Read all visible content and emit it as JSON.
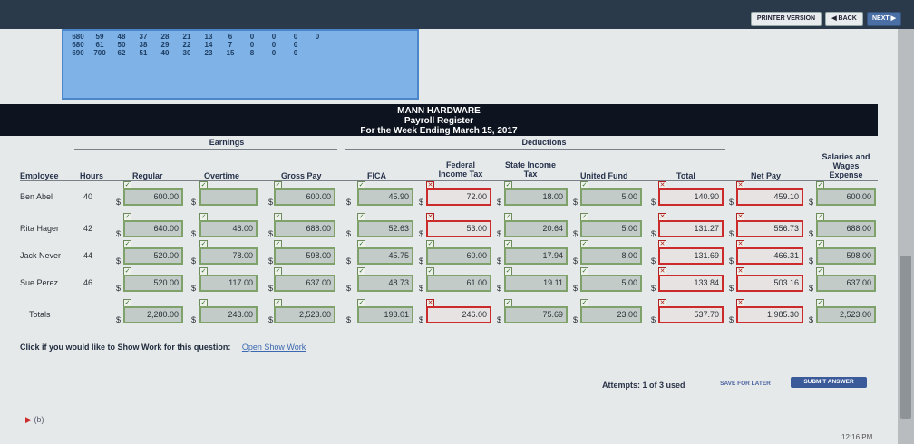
{
  "nav": {
    "printer": "PRINTER VERSION",
    "back": "◀ BACK",
    "next": "NEXT ▶"
  },
  "prev_rows": [
    [
      "680",
      "59",
      "48",
      "37",
      "28",
      "21",
      "13",
      "6",
      "0",
      "0",
      "0"
    ],
    [
      "680",
      "61",
      "50",
      "38",
      "29",
      "22",
      "14",
      "7",
      "0",
      "0",
      "0"
    ],
    [
      "690",
      "700",
      "62",
      "51",
      "40",
      "30",
      "23",
      "15",
      "8",
      "0",
      "0",
      "0"
    ]
  ],
  "report": {
    "company": "MANN HARDWARE",
    "title": "Payroll Register",
    "period": "For the Week Ending March 15, 2017"
  },
  "groups": {
    "earnings": "Earnings",
    "deductions": "Deductions"
  },
  "columns": {
    "employee": "Employee",
    "hours": "Hours",
    "regular": "Regular",
    "overtime": "Overtime",
    "gross": "Gross Pay",
    "fica": "FICA",
    "federal": "Federal Income Tax",
    "state": "State Income Tax",
    "fund": "United Fund",
    "total": "Total",
    "net": "Net Pay",
    "salaries": "Salaries and Wages Expense"
  },
  "rows": [
    {
      "name": "Ben Abel",
      "hours": "40",
      "regular": "600.00",
      "overtime": "",
      "gross": "600.00",
      "fica": "45.90",
      "federal": "72.00",
      "state": "18.00",
      "fund": "5.00",
      "total": "140.90",
      "net": "459.10",
      "salaries": "600.00"
    },
    {
      "name": "Rita Hager",
      "hours": "42",
      "regular": "640.00",
      "overtime": "48.00",
      "gross": "688.00",
      "fica": "52.63",
      "federal": "53.00",
      "state": "20.64",
      "fund": "5.00",
      "total": "131.27",
      "net": "556.73",
      "salaries": "688.00"
    },
    {
      "name": "Jack Never",
      "hours": "44",
      "regular": "520.00",
      "overtime": "78.00",
      "gross": "598.00",
      "fica": "45.75",
      "federal": "60.00",
      "state": "17.94",
      "fund": "8.00",
      "total": "131.69",
      "net": "466.31",
      "salaries": "598.00"
    },
    {
      "name": "Sue Perez",
      "hours": "46",
      "regular": "520.00",
      "overtime": "117.00",
      "gross": "637.00",
      "fica": "48.73",
      "federal": "61.00",
      "state": "19.11",
      "fund": "5.00",
      "total": "133.84",
      "net": "503.16",
      "salaries": "637.00"
    },
    {
      "name": "Totals",
      "hours": "",
      "regular": "2,280.00",
      "overtime": "243.00",
      "gross": "2,523.00",
      "fica": "193.01",
      "federal": "246.00",
      "state": "75.69",
      "fund": "23.00",
      "total": "537.70",
      "net": "1,985.30",
      "salaries": "2,523.00"
    }
  ],
  "footer": {
    "show_work": "Click if you would like to Show Work for this question:",
    "open_link": "Open Show Work",
    "attempts": "Attempts: 1 of 3 used",
    "save": "SAVE FOR LATER",
    "submit": "SUBMIT ANSWER",
    "part": "(b)",
    "time": "12:16 PM"
  },
  "colors": {
    "header_bg": "#0d1420",
    "ok_border": "#7ea26a",
    "bad_border": "#cc2b2b",
    "prev_table": "#7fb2e6"
  }
}
